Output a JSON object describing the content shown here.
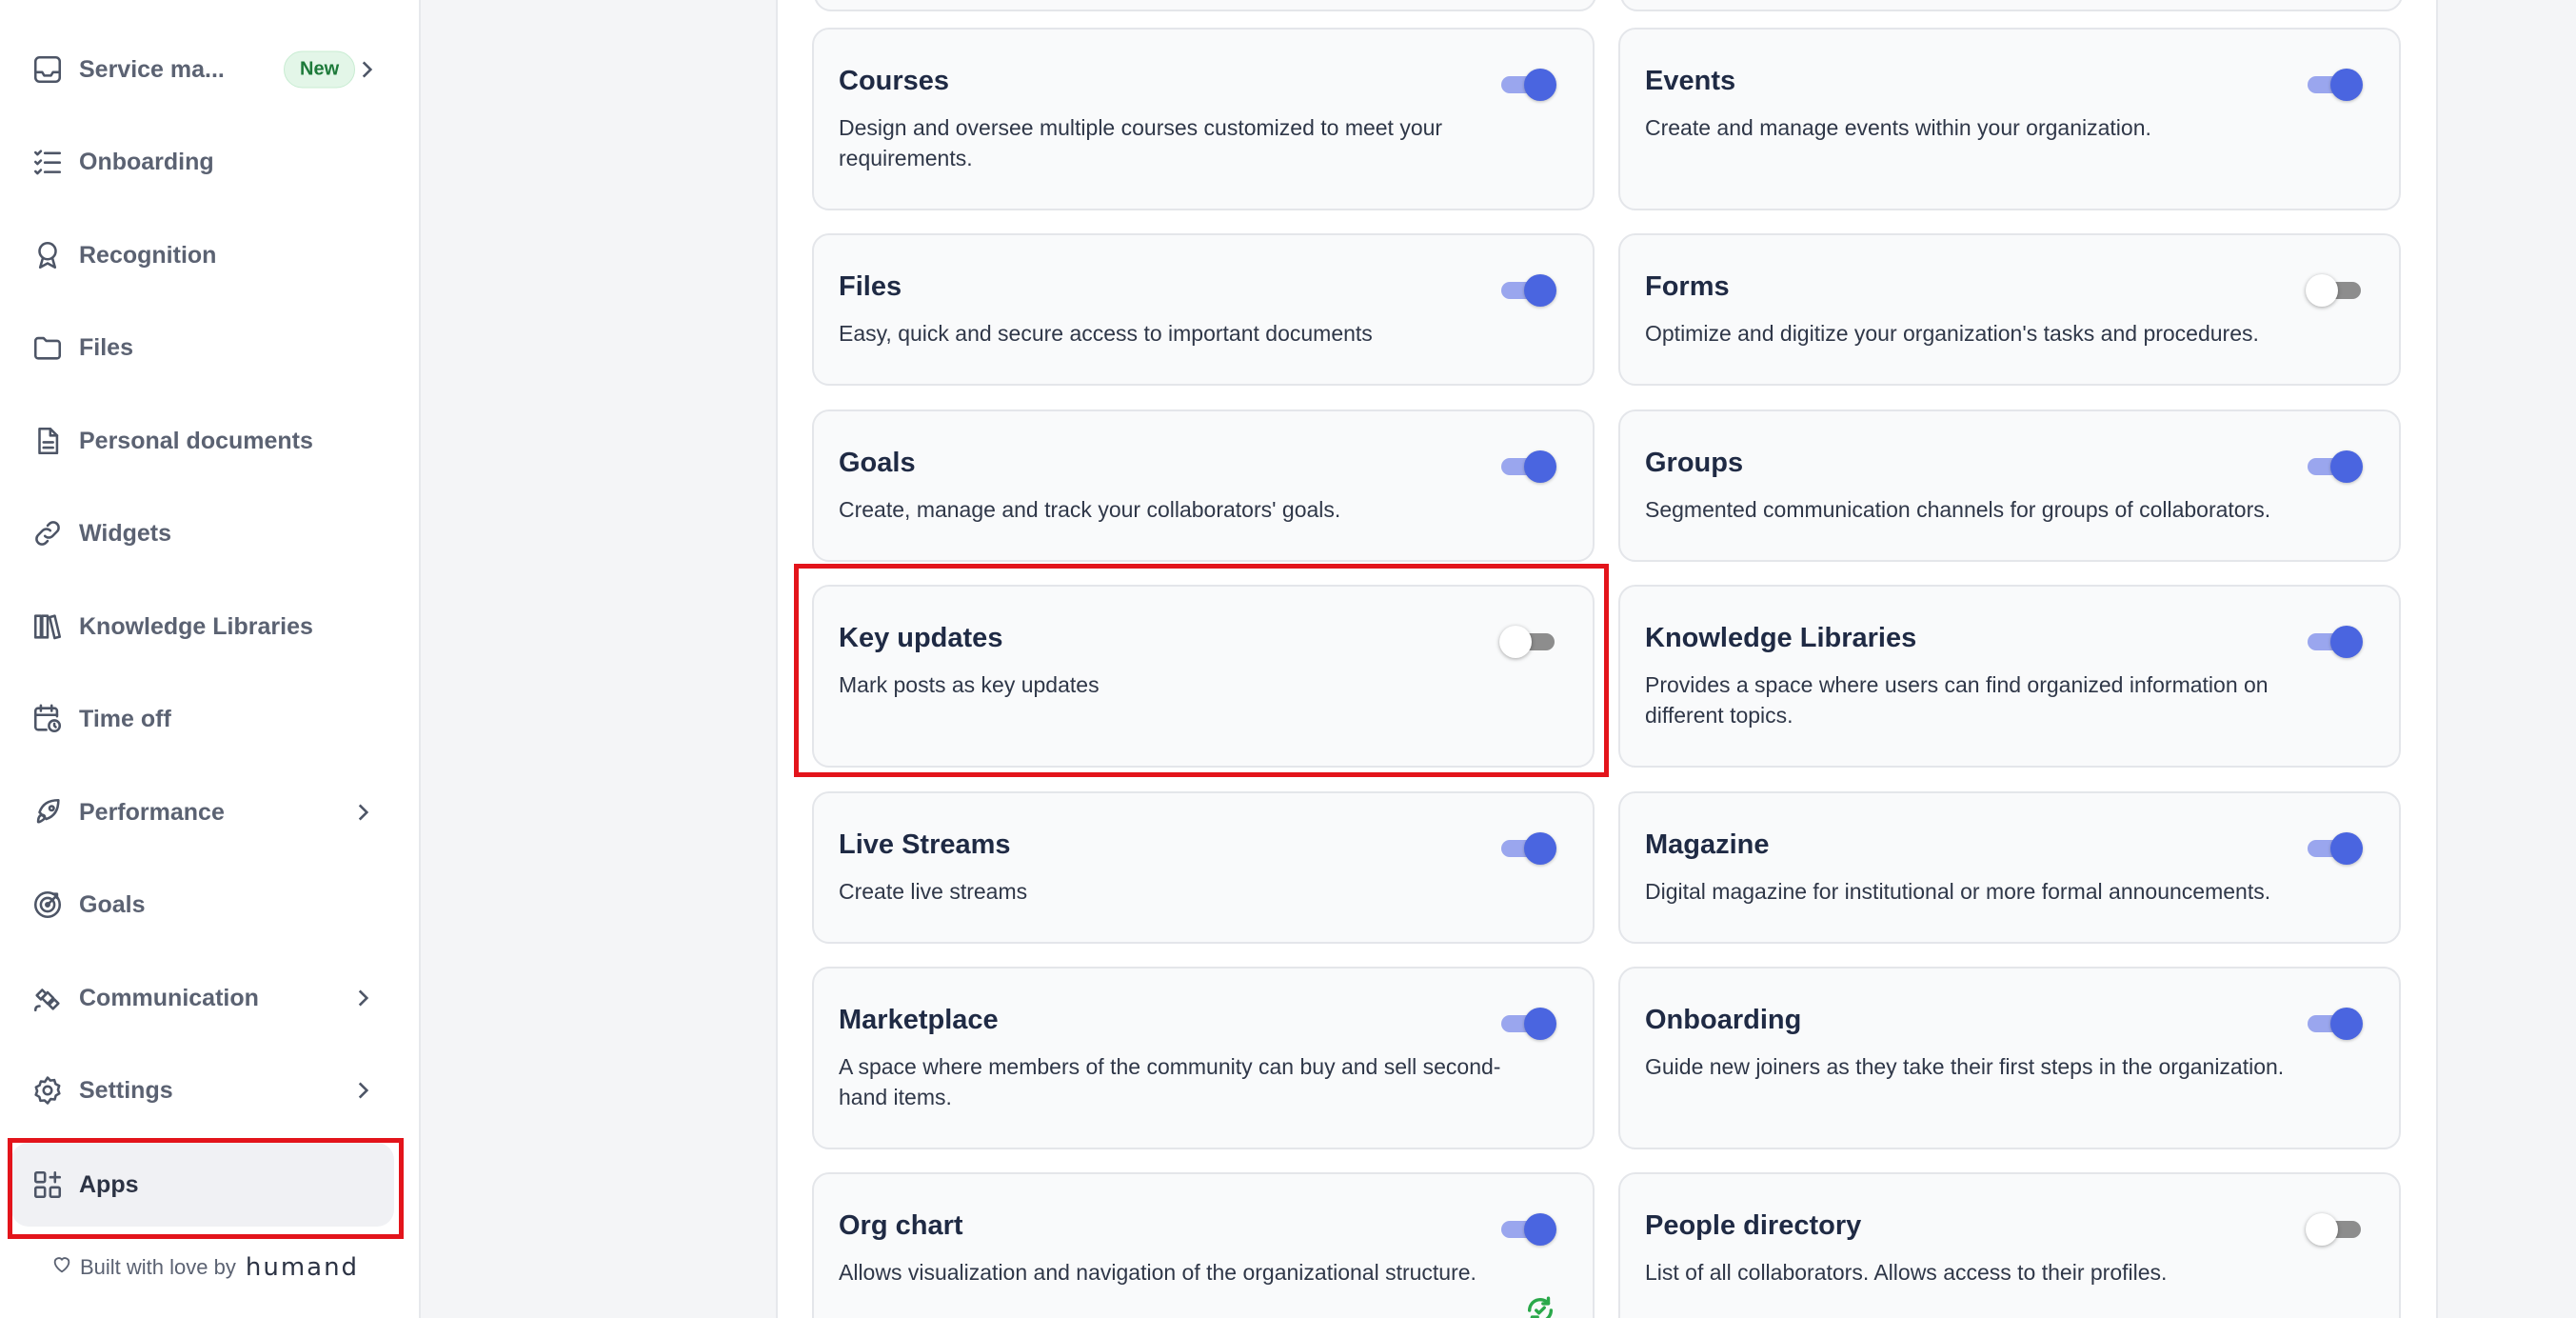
{
  "sidebar": {
    "items": [
      {
        "label": "Service ma...",
        "icon": "inbox-icon",
        "badge": "New",
        "has_chevron": true
      },
      {
        "label": "Onboarding",
        "icon": "checklist-icon"
      },
      {
        "label": "Recognition",
        "icon": "award-icon"
      },
      {
        "label": "Files",
        "icon": "folder-icon"
      },
      {
        "label": "Personal documents",
        "icon": "document-icon"
      },
      {
        "label": "Widgets",
        "icon": "link-icon"
      },
      {
        "label": "Knowledge Libraries",
        "icon": "books-icon"
      },
      {
        "label": "Time off",
        "icon": "calendar-clock-icon"
      },
      {
        "label": "Performance",
        "icon": "rocket-icon",
        "has_chevron": true
      },
      {
        "label": "Goals",
        "icon": "target-icon"
      },
      {
        "label": "Communication",
        "icon": "satellite-icon",
        "has_chevron": true
      },
      {
        "label": "Settings",
        "icon": "gear-icon",
        "has_chevron": true
      },
      {
        "label": "Apps",
        "icon": "apps-icon",
        "active": true
      }
    ],
    "footer": {
      "text": "Built with love by",
      "brand": "humand"
    }
  },
  "apps": [
    {
      "title": "Courses",
      "description": "Design and oversee multiple courses customized to meet your requirements.",
      "enabled": true
    },
    {
      "title": "Events",
      "description": "Create and manage events within your organization.",
      "enabled": true
    },
    {
      "title": "Files",
      "description": "Easy, quick and secure access to important documents",
      "enabled": true
    },
    {
      "title": "Forms",
      "description": "Optimize and digitize your organization's tasks and procedures.",
      "enabled": false
    },
    {
      "title": "Goals",
      "description": "Create, manage and track your collaborators' goals.",
      "enabled": true
    },
    {
      "title": "Groups",
      "description": "Segmented communication channels for groups of collaborators.",
      "enabled": true
    },
    {
      "title": "Key updates",
      "description": "Mark posts as key updates",
      "enabled": false
    },
    {
      "title": "Knowledge Libraries",
      "description": "Provides a space where users can find organized information on different topics.",
      "enabled": true
    },
    {
      "title": "Live Streams",
      "description": "Create live streams",
      "enabled": true
    },
    {
      "title": "Magazine",
      "description": "Digital magazine for institutional or more formal announcements.",
      "enabled": true
    },
    {
      "title": "Marketplace",
      "description": "A space where members of the community can buy and sell second-hand items.",
      "enabled": true
    },
    {
      "title": "Onboarding",
      "description": "Guide new joiners as they take their first steps in the organization.",
      "enabled": true
    },
    {
      "title": "Org chart",
      "description": "Allows visualization and navigation of the organizational structure.",
      "enabled": true,
      "status_icon": "sync-check-icon"
    },
    {
      "title": "People directory",
      "description": "List of all collaborators. Allows access to their profiles.",
      "enabled": false
    }
  ],
  "colors": {
    "toggle_on": "#4a65e0",
    "toggle_off_track": "#8d8d8d",
    "highlight": "#e3141b",
    "new_badge": "#1d7a3a"
  }
}
